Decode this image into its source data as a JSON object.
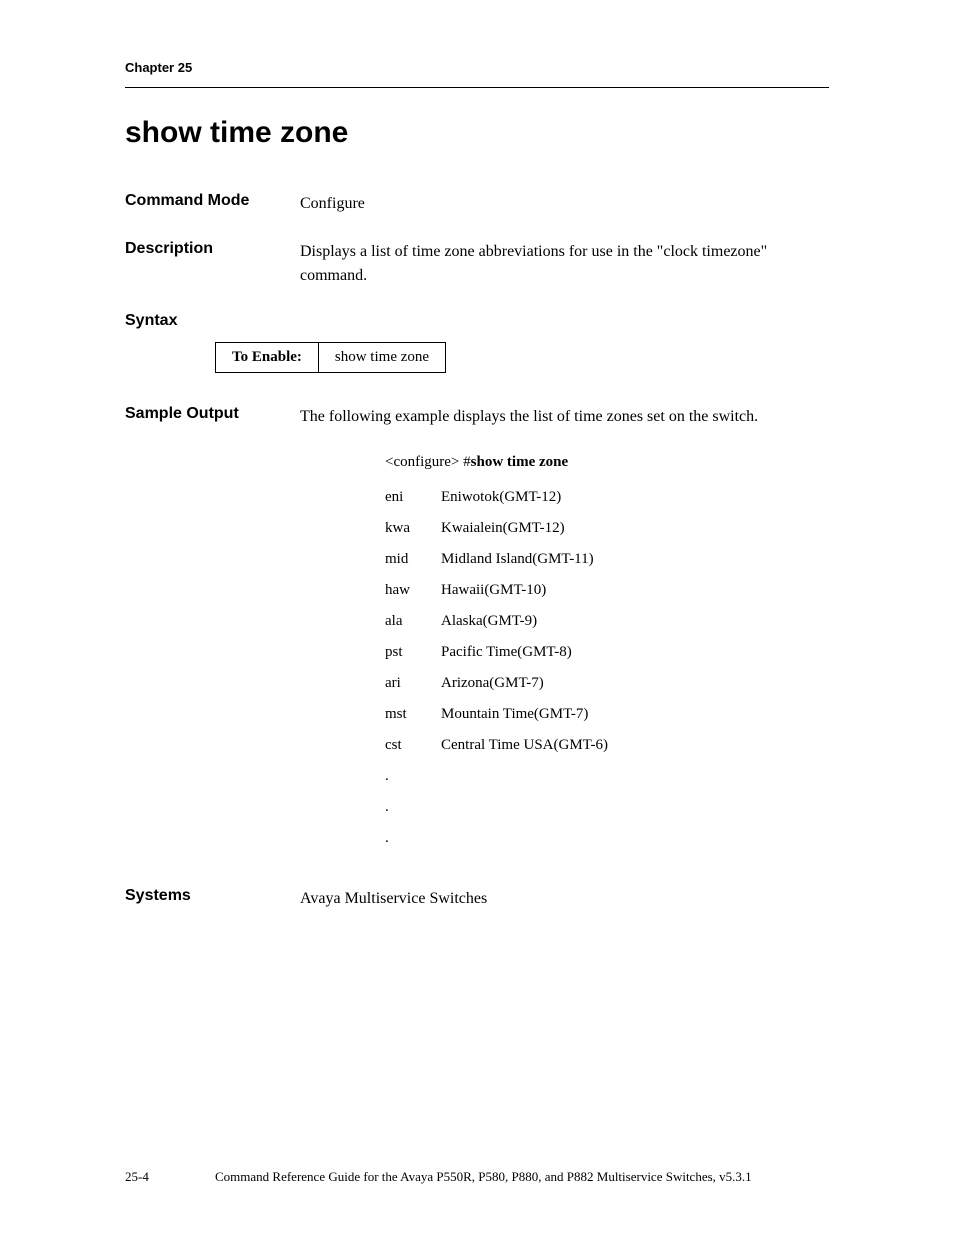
{
  "chapter": "Chapter 25",
  "title": "show time zone",
  "commandMode": {
    "label": "Command Mode",
    "value": "Configure"
  },
  "description": {
    "label": "Description",
    "value": "Displays a list of time zone abbreviations for use in the \"clock timezone\" command."
  },
  "syntax": {
    "label": "Syntax",
    "toEnable": "To Enable:",
    "command": "show time zone"
  },
  "sampleOutput": {
    "label": "Sample Output",
    "intro": "The following example displays the list of time zones set on the switch.",
    "promptPrefix": "<configure> #",
    "promptCommand": "show time zone",
    "rows": [
      {
        "code": "eni",
        "desc": "Eniwotok(GMT-12)"
      },
      {
        "code": "kwa",
        "desc": "Kwaialein(GMT-12)"
      },
      {
        "code": "mid",
        "desc": "Midland Island(GMT-11)"
      },
      {
        "code": "haw",
        "desc": "Hawaii(GMT-10)"
      },
      {
        "code": "ala",
        "desc": "Alaska(GMT-9)"
      },
      {
        "code": "pst",
        "desc": "Pacific Time(GMT-8)"
      },
      {
        "code": "ari",
        "desc": "Arizona(GMT-7)"
      },
      {
        "code": "mst",
        "desc": "Mountain Time(GMT-7)"
      },
      {
        "code": "cst",
        "desc": "Central Time USA(GMT-6)"
      }
    ],
    "dots": [
      ".",
      ".",
      "."
    ]
  },
  "systems": {
    "label": "Systems",
    "value": "Avaya Multiservice Switches"
  },
  "footer": {
    "page": "25-4",
    "text": "Command Reference Guide for the Avaya P550R, P580, P880, and P882 Multiservice Switches, v5.3.1"
  }
}
